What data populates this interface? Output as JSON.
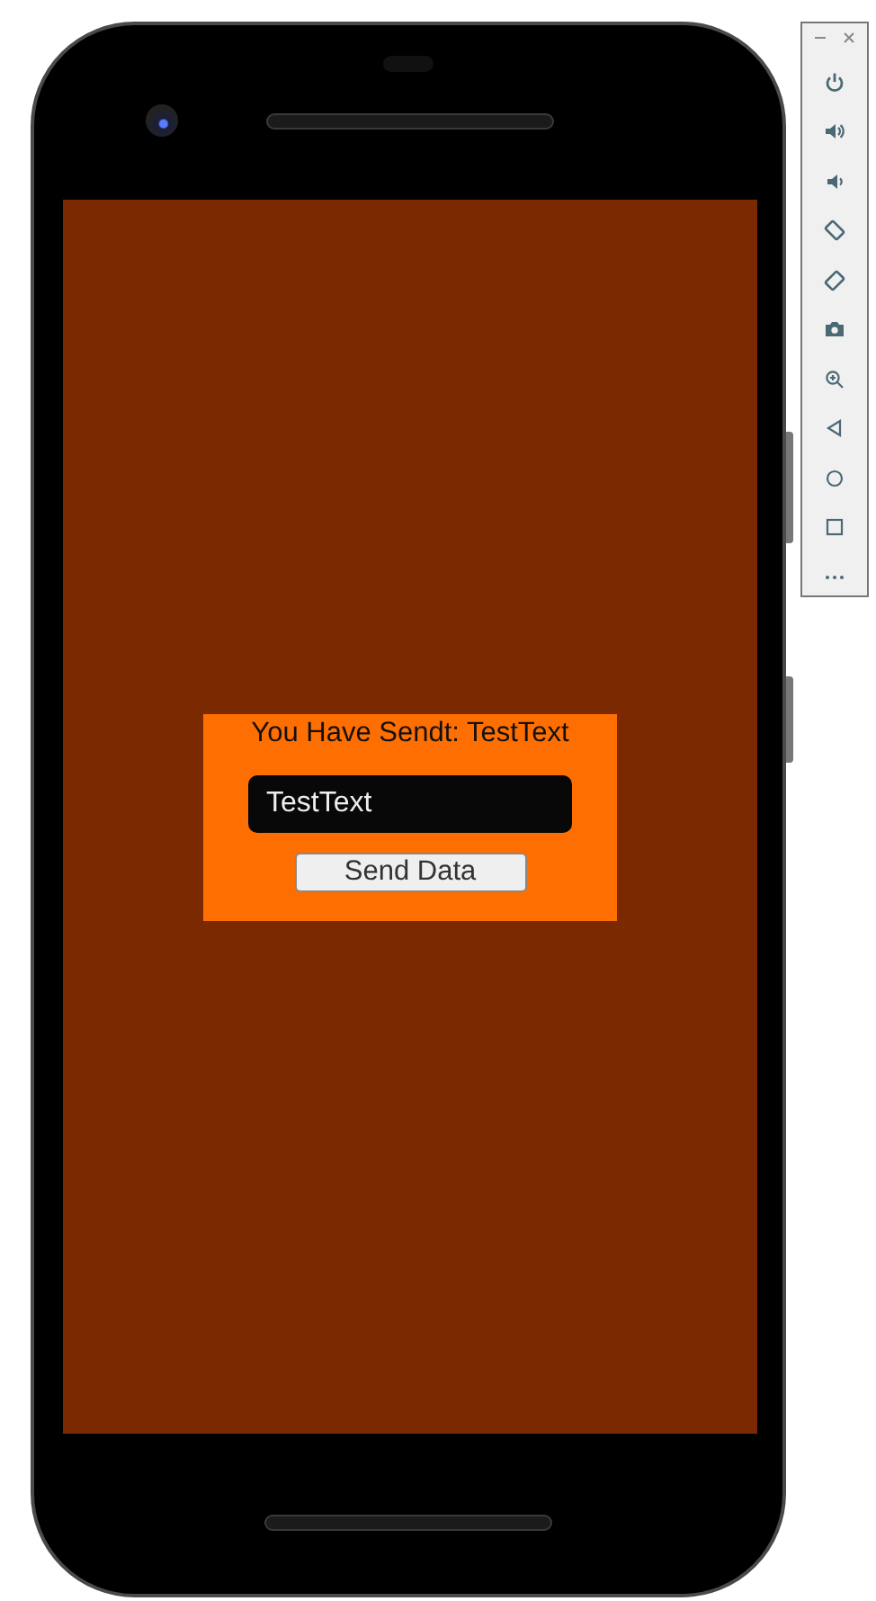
{
  "app": {
    "status_text": "You Have Sendt: TestText",
    "input": {
      "value": "TestText"
    },
    "send_button": {
      "label": "Send Data"
    }
  }
}
